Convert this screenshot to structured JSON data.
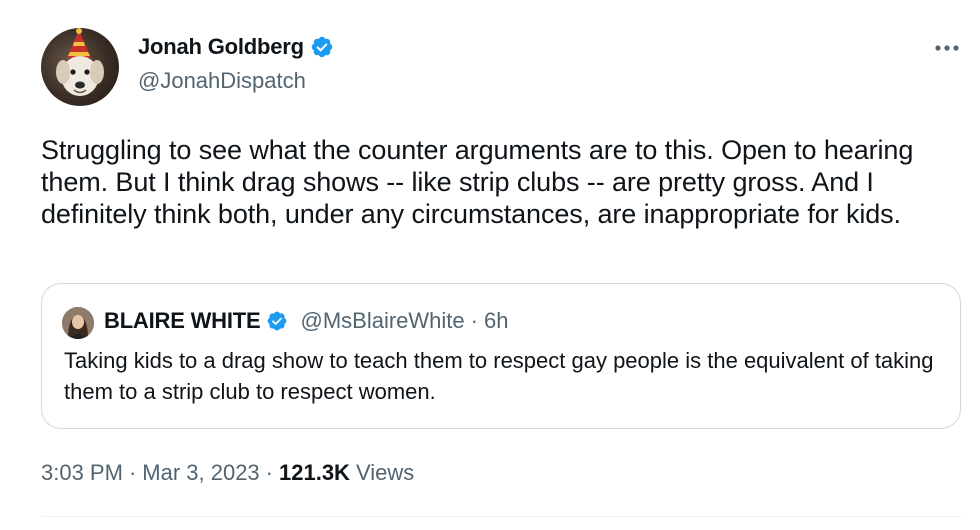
{
  "author": {
    "name": "Jonah Goldberg",
    "handle": "@JonahDispatch",
    "verified": true
  },
  "tweet": {
    "text": "Struggling to see what the counter arguments are to this. Open to hearing them. But I think drag shows -- like strip clubs -- are pretty gross. And I definitely think both, under any circumstances, are inappropriate for kids."
  },
  "quote": {
    "name": "BLAIRE WHITE",
    "handle": "@MsBlaireWhite",
    "separator": "·",
    "time": "6h",
    "text": "Taking kids to a drag show to teach them to respect gay people is the equivalent of taking them to a strip club to respect women."
  },
  "meta": {
    "time": "3:03 PM",
    "sep1": "·",
    "date": "Mar 3, 2023",
    "sep2": "·",
    "views_count": "121.3K",
    "views_label": "Views"
  },
  "colors": {
    "verified_blue": "#1d9bf0",
    "secondary_text": "#536471",
    "border": "#cfd9de"
  },
  "icons": {
    "more": "more-dots-icon",
    "verified": "verified-badge-icon"
  }
}
